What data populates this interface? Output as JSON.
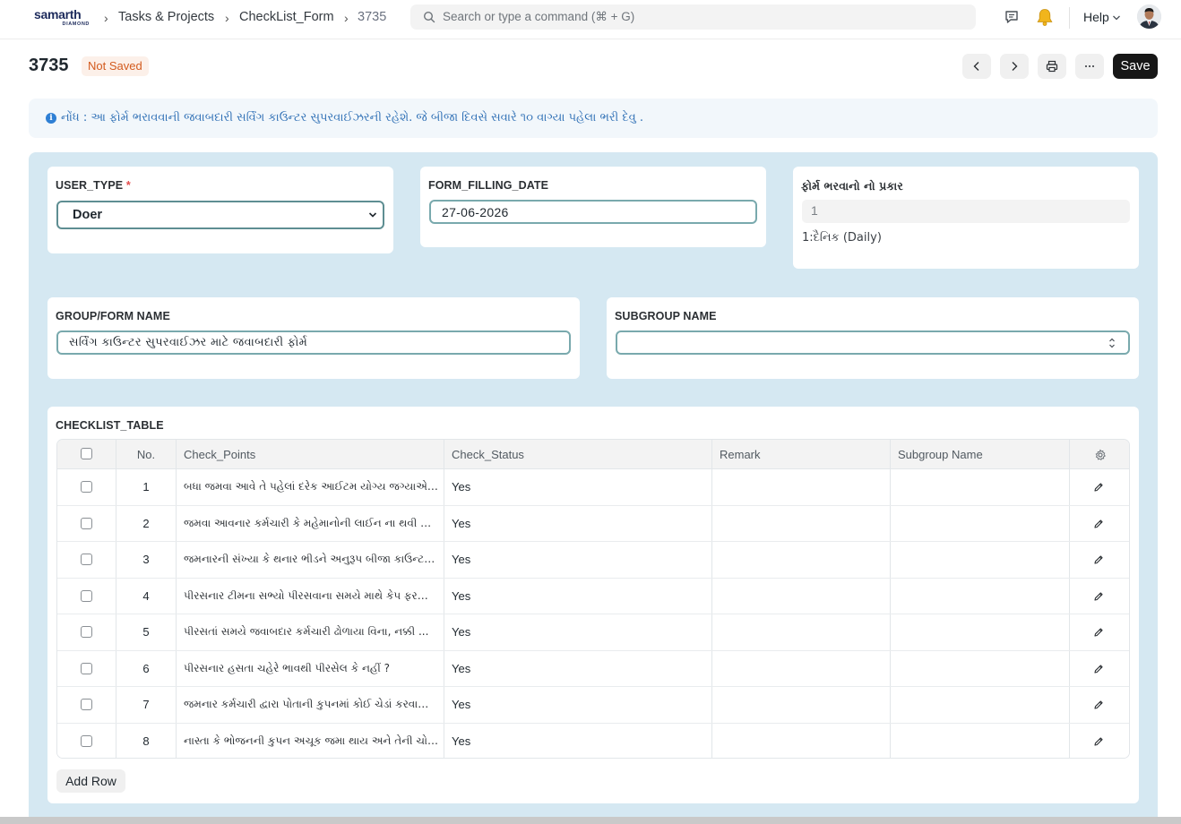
{
  "navbar": {
    "logo_word": "samarth",
    "logo_sub": "DIAMOND",
    "breadcrumbs": [
      "Tasks & Projects",
      "CheckList_Form",
      "3735"
    ],
    "search_placeholder": "Search or type a command (⌘ + G)",
    "help_label": "Help",
    "icons": [
      "chat-icon",
      "bell-icon",
      "chevron-down-icon",
      "avatar"
    ]
  },
  "page": {
    "title": "3735",
    "status_badge": "Not Saved",
    "save_label": "Save",
    "note": "નોંધ : આ ફોર્મ ભરાવવાની જવાબદારી સર્વિંગ કાઉન્ટર સુપરવાઈઝરની રહેશે. જે બીજા દિવસે સવારે ૧૦ વાગ્યા પહેલા ભરી દેવુ ."
  },
  "fields": {
    "user_type": {
      "label": "USER_TYPE",
      "required": "*",
      "value": "Doer"
    },
    "form_filling_date": {
      "label": "FORM_FILLING_DATE",
      "value": "27-06-2026"
    },
    "form_kind": {
      "label": "ફોર્મ ભરવાનો નો પ્રકાર",
      "value": "1",
      "help": "1:દૈનિક (Daily)"
    },
    "group_form_name": {
      "label": "GROUP/FORM NAME",
      "value": "સર્વિંગ કાઉન્ટર સુપરવાઈઝર માટે જવાબદારી ફોર્મ"
    },
    "subgroup_name": {
      "label": "SUBGROUP NAME",
      "value": ""
    }
  },
  "checklist": {
    "label": "CHECKLIST_TABLE",
    "columns": [
      "No.",
      "Check_Points",
      "Check_Status",
      "Remark",
      "Subgroup Name"
    ],
    "rows": [
      {
        "no": "1",
        "check_point": "બધા જમવા આવે તે પહેલાં દરેક આઈટમ યોગ્ય જગ્યાએ ...",
        "status": "Yes",
        "remark": "",
        "subgroup": ""
      },
      {
        "no": "2",
        "check_point": "જમવા આવનાર કર્મચારી કે મહેમાનોની લાઈન ના થવી જોઈ...",
        "status": "Yes",
        "remark": "",
        "subgroup": ""
      },
      {
        "no": "3",
        "check_point": "જમનારની સંખ્યા કે થનાર ભીડને અનુરૂપ બીજા કાઉન્ટ સ...",
        "status": "Yes",
        "remark": "",
        "subgroup": ""
      },
      {
        "no": "4",
        "check_point": "પીરસનાર ટીમના સભ્યો પીરસવાના સમયે માથે કેપ ફરજી...",
        "status": "Yes",
        "remark": "",
        "subgroup": ""
      },
      {
        "no": "5",
        "check_point": "પીરસતાં સમયે જવાબદાર કર્મચારી ઢોળાયા વિના, નક્કી ...",
        "status": "Yes",
        "remark": "",
        "subgroup": ""
      },
      {
        "no": "6",
        "check_point": "પીરસનાર હસતા ચહેરે ભાવથી પીરસેલ કે નહીં ?",
        "status": "Yes",
        "remark": "",
        "subgroup": ""
      },
      {
        "no": "7",
        "check_point": "જમનાર કર્મચારી દ્વારા પોતાની કુપનમાં કોઈ ચેડાં કરવામાં ...",
        "status": "Yes",
        "remark": "",
        "subgroup": ""
      },
      {
        "no": "8",
        "check_point": "નાસ્તા કે ભોજનની કુપન અચૂક જમા થાય અને તેની ચોક્ક...",
        "status": "Yes",
        "remark": "",
        "subgroup": ""
      }
    ],
    "add_row_label": "Add Row"
  },
  "colors": {
    "form_background": "#d5e8f2",
    "save_button": "#171717",
    "badge_text": "#d35b1e",
    "note_text": "#2e6fb5"
  }
}
